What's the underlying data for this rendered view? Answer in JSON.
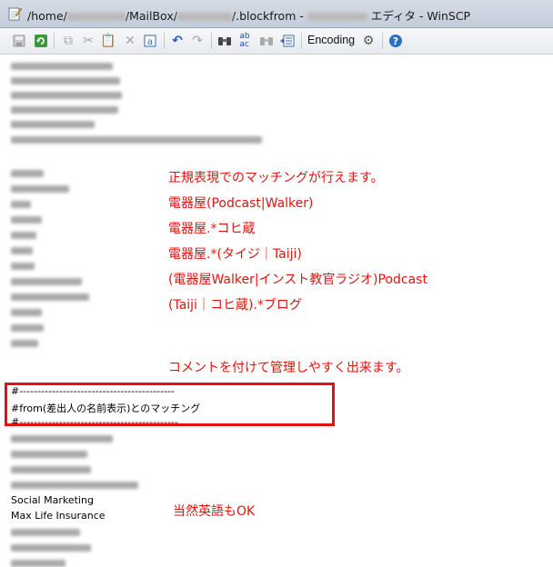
{
  "window": {
    "title_prefix": "/home/",
    "title_mid1": "/MailBox/",
    "title_mid2": "/.blockfrom - ",
    "title_suffix": " エディタ - WinSCP"
  },
  "toolbar": {
    "encoding_label": "Encoding"
  },
  "editor": {
    "comment_lines": [
      "#-------------------------------------------",
      "#from(差出人の名前表示)とのマッチング",
      "#--------------------------------------------"
    ],
    "plain_lines": [
      "Social Marketing",
      "Max Life Insurance"
    ]
  },
  "annotations": [
    "正規表現でのマッチングが行えます。",
    "電器屋(Podcast|Walker)",
    "電器屋.*コヒ蔵",
    "電器屋.*(タイジ｜Taiji)",
    "(電器屋Walker|インスト教官ラジオ)Podcast",
    "(Taiji｜コヒ蔵).*ブログ",
    "コメントを付けて管理しやすく出来ます。",
    "当然英語もOK"
  ],
  "colors": {
    "annotation": "#e3120b",
    "highlight_box": "#e3120b"
  }
}
